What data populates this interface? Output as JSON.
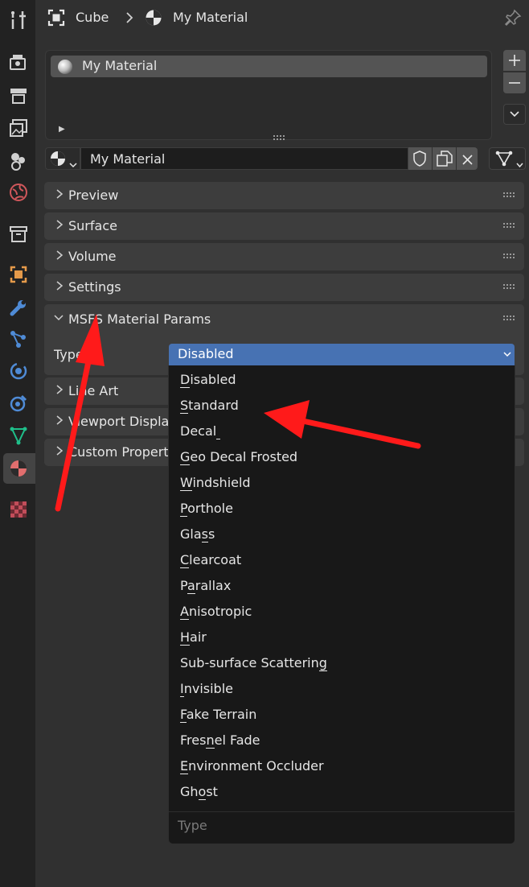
{
  "header": {
    "object_name": "Cube",
    "material_name": "My Material"
  },
  "material_slots": [
    {
      "label": "My Material"
    }
  ],
  "datablock": {
    "name_value": "My Material"
  },
  "panels": {
    "preview": "Preview",
    "surface": "Surface",
    "volume": "Volume",
    "settings": "Settings",
    "msfs": "MSFS Material Params",
    "line_art": "Line Art",
    "viewport_display": "Viewport Displa",
    "custom_properties": "Custom Propert"
  },
  "msfs": {
    "type_label": "Type",
    "type_value": "Disabled"
  },
  "dropdown": {
    "search_placeholder": "Type",
    "options": [
      {
        "pre": "",
        "u": "D",
        "post": "isabled"
      },
      {
        "pre": "",
        "u": "S",
        "post": "tandard"
      },
      {
        "pre": "Decal",
        "u": " ",
        "post": ""
      },
      {
        "pre": "",
        "u": "G",
        "post": "eo Decal Frosted"
      },
      {
        "pre": "",
        "u": "W",
        "post": "indshield"
      },
      {
        "pre": "",
        "u": "P",
        "post": "orthole"
      },
      {
        "pre": "Gla",
        "u": "s",
        "post": "s"
      },
      {
        "pre": "",
        "u": "C",
        "post": "learcoat"
      },
      {
        "pre": "P",
        "u": "a",
        "post": "rallax"
      },
      {
        "pre": "",
        "u": "A",
        "post": "nisotropic"
      },
      {
        "pre": "",
        "u": "H",
        "post": "air"
      },
      {
        "pre": "Sub-surface Scatterin",
        "u": "g",
        "post": ""
      },
      {
        "pre": "",
        "u": "I",
        "post": "nvisible"
      },
      {
        "pre": "",
        "u": "F",
        "post": "ake Terrain"
      },
      {
        "pre": "Fres",
        "u": "n",
        "post": "el Fade"
      },
      {
        "pre": "",
        "u": "E",
        "post": "nvironment Occluder"
      },
      {
        "pre": "Gh",
        "u": "o",
        "post": "st"
      }
    ]
  },
  "sidebar_icons": [
    "tool-icon",
    "render-icon",
    "output-icon",
    "view-layer-icon",
    "scene-icon",
    "world-icon",
    "collection-icon",
    "object-icon",
    "modifier-icon",
    "particles-icon",
    "physics-icon",
    "constraints-icon",
    "data-icon",
    "material-icon",
    "texture-icon"
  ],
  "colors": {
    "accent_blue": "#4772b3",
    "annotation_red": "#ff1a1a",
    "background": "#303030"
  }
}
